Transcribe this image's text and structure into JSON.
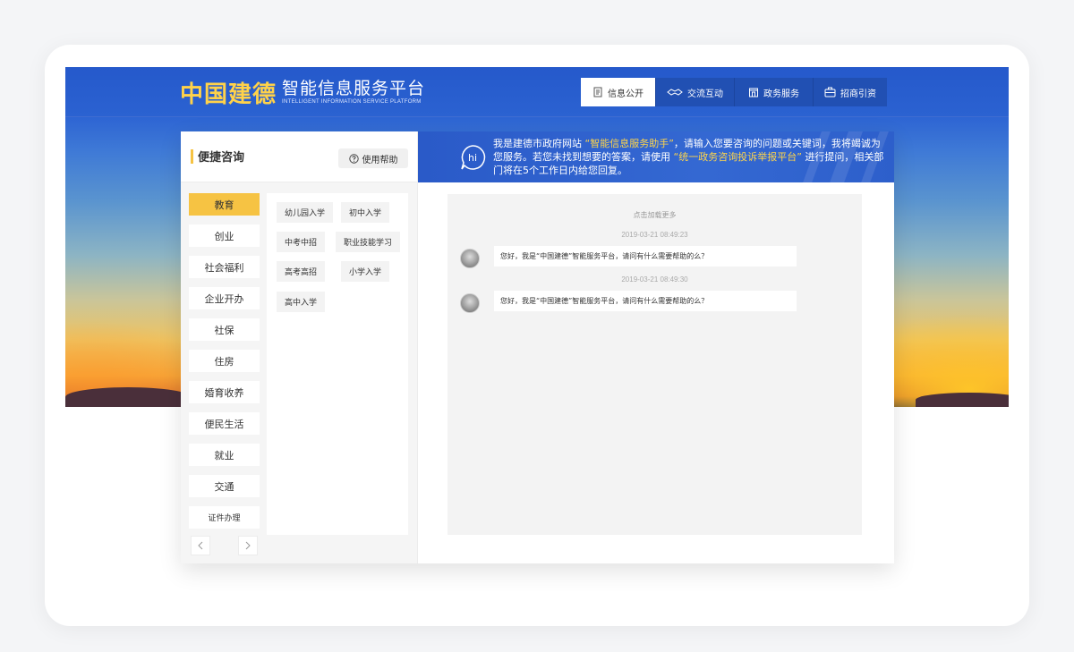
{
  "header": {
    "logo_main": "中国建德",
    "logo_title": "智能信息服务平台",
    "logo_subtitle": "INTELLIGENT INFORMATION SERVICE PLATFORM",
    "nav": [
      {
        "label": "信息公开",
        "icon": "document-icon"
      },
      {
        "label": "交流互动",
        "icon": "handshake-icon"
      },
      {
        "label": "政务服务",
        "icon": "building-icon"
      },
      {
        "label": "招商引资",
        "icon": "briefcase-icon"
      }
    ]
  },
  "left": {
    "title": "便捷咨询",
    "help_label": "使用帮助",
    "categories": [
      "教育",
      "创业",
      "社会福利",
      "企业开办",
      "社保",
      "住房",
      "婚育收养",
      "便民生活",
      "就业",
      "交通",
      "证件办理"
    ],
    "subcategories": [
      "幼儿园入学",
      "初中入学",
      "中考中招",
      "职业技能学习",
      "高考高招",
      "小学入学",
      "高中入学"
    ]
  },
  "banner": {
    "icon_text": "hi",
    "text_1": "我是建德市政府网站 ",
    "highlight_1": "“智能信息服务助手”",
    "text_2": "，请输入您要咨询的问题或关键词，我将竭诚为您服务。若您未找到想要的答案，请使用 ",
    "highlight_2": "“统一政务咨询投诉举报平台”",
    "text_3": " 进行提问，相关部门将在5个工作日内给您回复。"
  },
  "chat": {
    "load_more": "点击加载更多",
    "messages": [
      {
        "time": "2019-03-21 08:49:23",
        "text": "您好，我是“中国建德”智能服务平台，请问有什么需要帮助的么？"
      },
      {
        "time": "2019-03-21 08:49:30",
        "text": "您好，我是“中国建德”智能服务平台，请问有什么需要帮助的么？"
      }
    ]
  },
  "colors": {
    "accent_yellow": "#f6c343",
    "nav_blue": "#2150b3",
    "header_blue": "#2b62d1"
  }
}
